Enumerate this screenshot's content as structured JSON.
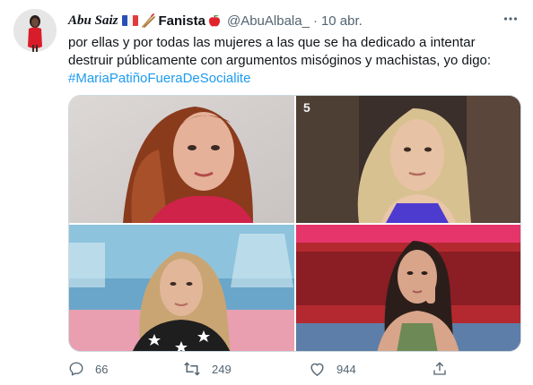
{
  "tweet": {
    "display_name": "Abu Saiz",
    "fan_label": "Fanista",
    "handle": "@AbuAlbala_",
    "separator": "·",
    "date": "10 abr.",
    "text_line1": "por ellas y por todas las mujeres a las que se ha dedicado a intentar",
    "text_line2": "destruir públicamente con argumentos misóginos y machistas, yo digo:",
    "hashtag": "#MariaPatiñoFueraDeSocialite"
  },
  "icons": {
    "flag": "france-flag-icon",
    "chopsticks": "chopsticks-icon",
    "apple": "red-apple-icon",
    "more": "more-icon",
    "reply": "reply-icon",
    "retweet": "retweet-icon",
    "like": "heart-icon",
    "share": "share-icon"
  },
  "media": {
    "watermark": "5"
  },
  "stats": {
    "replies": "66",
    "retweets": "249",
    "likes": "944"
  },
  "colors": {
    "accent": "#1d9bf0",
    "secondary_text": "#536471",
    "text": "#0f1419",
    "border": "#cfd9de"
  }
}
